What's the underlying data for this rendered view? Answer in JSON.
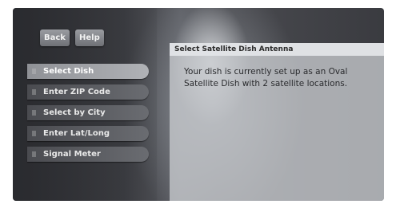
{
  "top_buttons": {
    "back": "Back",
    "help": "Help"
  },
  "menu": {
    "items": [
      {
        "label": "Select Dish",
        "selected": true
      },
      {
        "label": "Enter ZIP Code",
        "selected": false
      },
      {
        "label": "Select by City",
        "selected": false
      },
      {
        "label": "Enter Lat/Long",
        "selected": false
      },
      {
        "label": "Signal Meter",
        "selected": false
      }
    ]
  },
  "panel": {
    "title": "Select Satellite Dish Antenna",
    "body": "Your dish is currently set up as an Oval Satellite Dish with 2 satellite locations."
  }
}
